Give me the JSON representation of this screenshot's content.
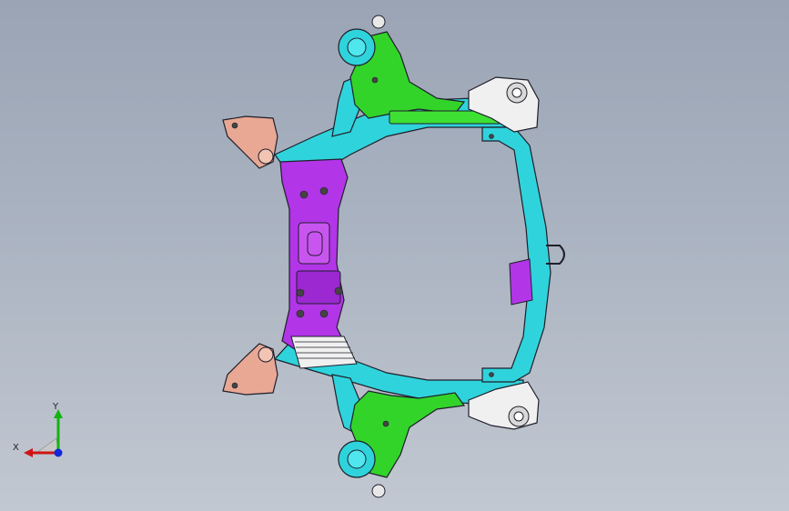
{
  "viewport": {
    "background_top": "#9aa4b4",
    "background_bottom": "#c2c8d1"
  },
  "model": {
    "part_colors": {
      "subframe_rail": "#2fd3dc",
      "center_crossmember": "#b235e8",
      "control_arm": "#33d42a",
      "rear_mount_bracket": "#f0f0f0",
      "front_bracket": "#e8a894",
      "edge_line": "#1f1f2a"
    }
  },
  "triad": {
    "x_label": "X",
    "y_label": "Y",
    "x_color": "#d01414",
    "y_color": "#12b312",
    "z_color": "#1028d8"
  }
}
